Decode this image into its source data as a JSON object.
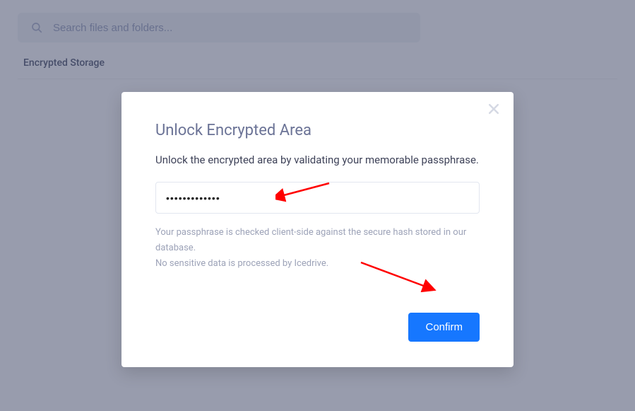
{
  "header": {
    "search_placeholder": "Search files and folders...",
    "tab_label": "Encrypted Storage"
  },
  "modal": {
    "title": "Unlock Encrypted Area",
    "description": "Unlock the encrypted area by validating your memorable passphrase.",
    "passphrase_value": "•••••••••••••",
    "help_line1": "Your passphrase is checked client-side against the secure hash stored in our database.",
    "help_line2": "No sensitive data is processed by Icedrive.",
    "confirm_label": "Confirm"
  }
}
